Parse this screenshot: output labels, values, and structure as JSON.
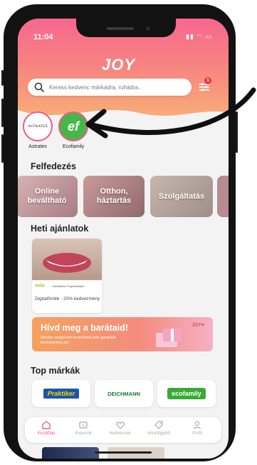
{
  "status_bar": {
    "time": "11:04",
    "icons": "▮▮ ◠ ▭"
  },
  "header": {
    "logo": "JOY",
    "search_placeholder": "Keress kedvenc márkádra, ruhádra..",
    "filter_badge": "1"
  },
  "stories": [
    {
      "label": "Astratex",
      "logo_text": "ASTRATEX"
    },
    {
      "label": "Ecofamily",
      "logo_text": "ef"
    }
  ],
  "explore": {
    "title": "Felfedezés",
    "cards": [
      {
        "label": "Online beváltható"
      },
      {
        "label": "Otthon, háztartás"
      },
      {
        "label": "Szolgáltatás"
      }
    ]
  },
  "weekly": {
    "title": "Heti ajánlatok",
    "offer": {
      "brand": "mile",
      "sub": "Láthatatlan Fogszabályzó",
      "text": "DigitalSmile - 20% kedvezmény"
    }
  },
  "promo": {
    "title": "Hívd meg a barátaid!",
    "text": "Minden meghívott ismerősöd után garantált kedvezmény jár!",
    "logo": "JOY♥"
  },
  "top_brands": {
    "title": "Top márkák",
    "brands": [
      {
        "name": "Praktiker",
        "color": "#1a56a8"
      },
      {
        "name": "DEICHMANN",
        "color": "#0f7a3a"
      },
      {
        "name": "ecofamily",
        "color": "#3aaa35"
      }
    ]
  },
  "tabs": [
    {
      "label": "Kezdőlap",
      "icon": "home-icon",
      "active": true
    },
    {
      "label": "Kuponok",
      "icon": "coupon-icon",
      "active": false
    },
    {
      "label": "Kedvencek",
      "icon": "heart-icon",
      "active": false
    },
    {
      "label": "Akciófigyelő",
      "icon": "tag-icon",
      "active": false
    },
    {
      "label": "Profil",
      "icon": "profile-icon",
      "active": false
    }
  ],
  "colors": {
    "accent": "#f15c8b",
    "gradient_top": "#f7668f",
    "gradient_bottom": "#f8b476"
  }
}
